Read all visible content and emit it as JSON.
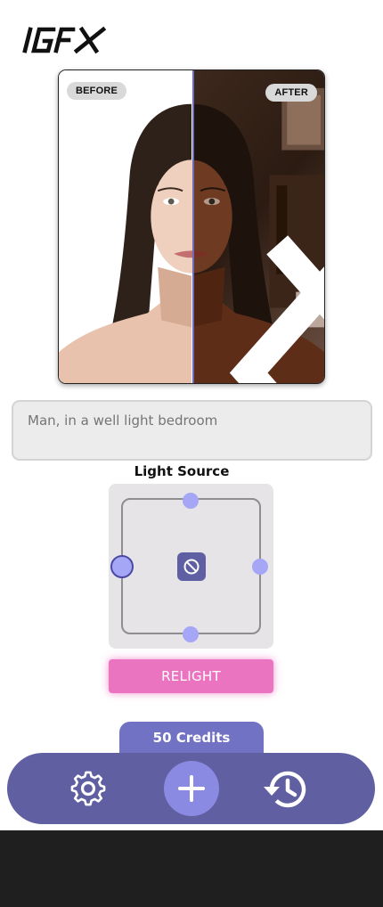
{
  "app": {
    "logo_text": "IGFX"
  },
  "compare": {
    "before_label": "BEFORE",
    "after_label": "AFTER"
  },
  "prompt": {
    "placeholder": "Man, in a well light bedroom"
  },
  "light_source": {
    "title": "Light Source",
    "selected_position": "left"
  },
  "actions": {
    "relight_label": "RELIGHT"
  },
  "credits": {
    "label": "50 Credits"
  },
  "nav": {
    "items": [
      "settings-icon",
      "add-icon",
      "history-icon"
    ]
  },
  "colors": {
    "accent": "#5f5fa2",
    "relight": "#ea74c0",
    "dot": "#a6a6f6"
  }
}
